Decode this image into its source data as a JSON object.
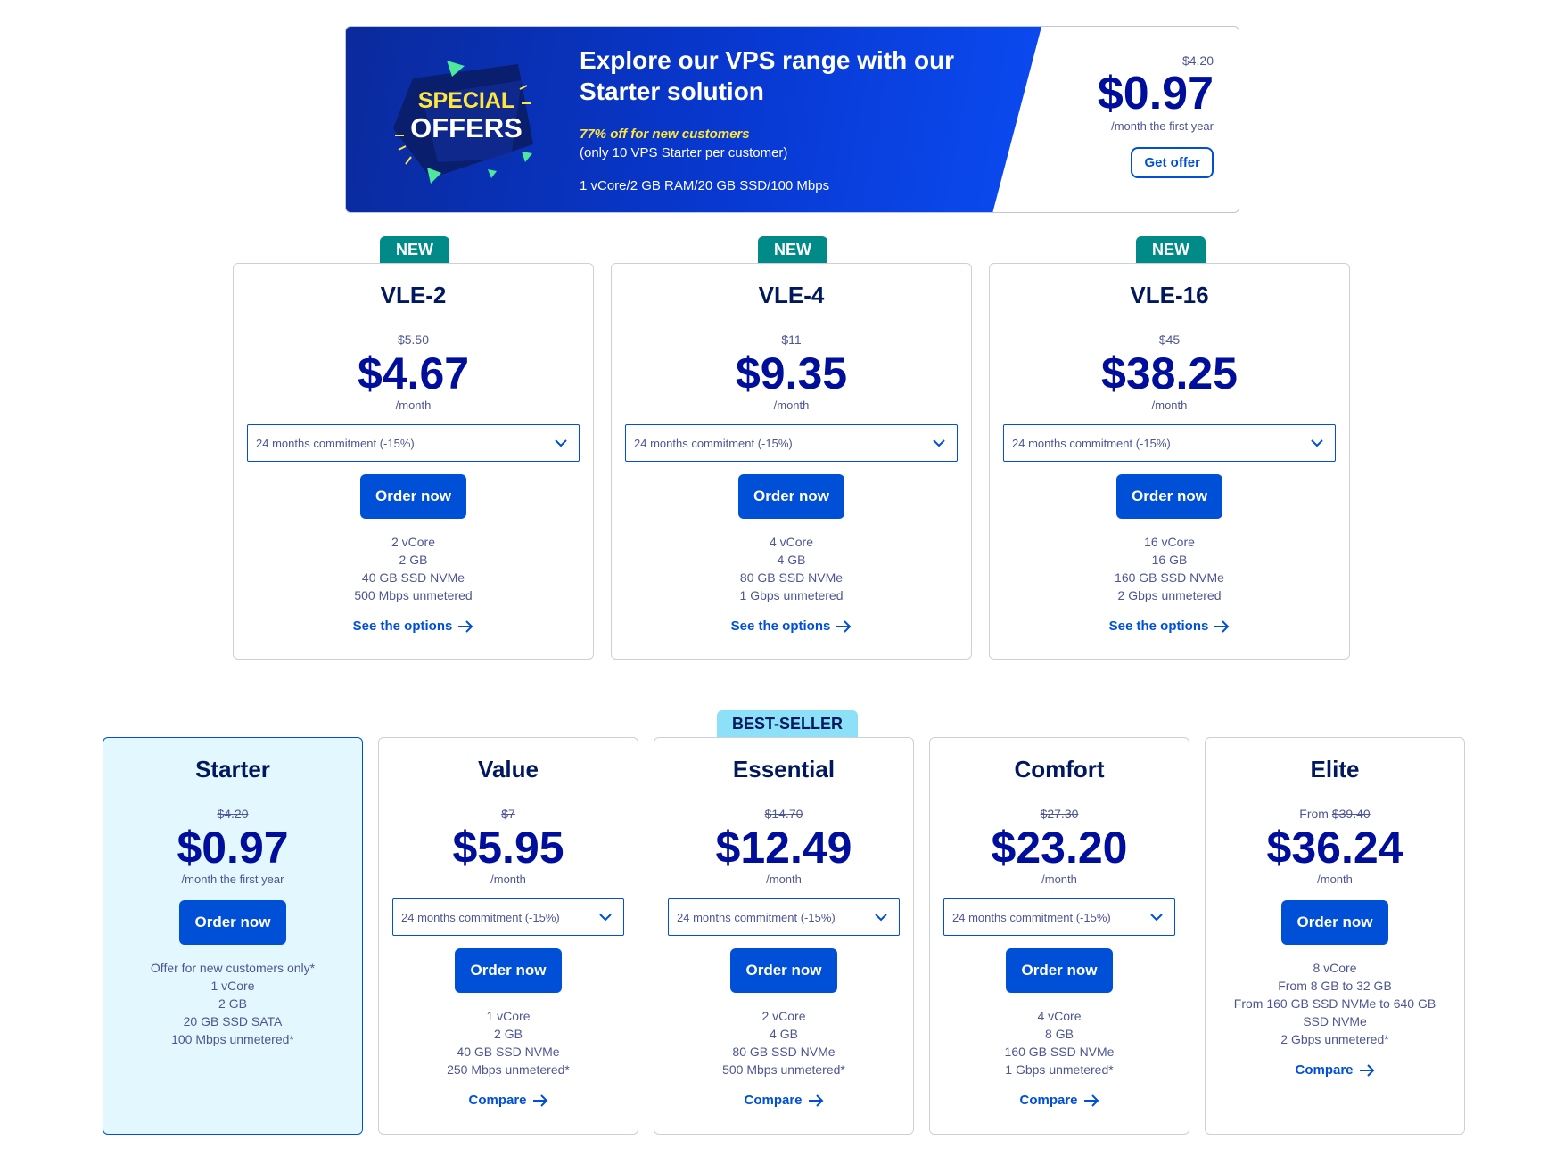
{
  "colors": {
    "primary": "#0050d7",
    "price": "#000e9c",
    "new_tag": "#008a88",
    "best_seller_tag": "#8ce1f8",
    "starter_bg": "#e3f8fe"
  },
  "banner": {
    "badge_line1": "SPECIAL",
    "badge_line2": "OFFERS",
    "title": "Explore our VPS range with our Starter solution",
    "highlight": "77% off for new customers",
    "note": "(only 10 VPS Starter per customer)",
    "spec": "1 vCore/2 GB RAM/20 GB SSD/100 Mbps",
    "old_price": "$4.20",
    "price": "$0.97",
    "period": "/month the first year",
    "button": "Get offer"
  },
  "vle_cards": [
    {
      "tag": "NEW",
      "name": "VLE-2",
      "old_price": "$5.50",
      "price": "$4.67",
      "period": "/month",
      "commitment": "24 months commitment (-15%)",
      "button": "Order now",
      "features": [
        "2 vCore",
        "2 GB",
        "40 GB SSD NVMe",
        "500 Mbps unmetered"
      ],
      "link": "See the options"
    },
    {
      "tag": "NEW",
      "name": "VLE-4",
      "old_price": "$11",
      "price": "$9.35",
      "period": "/month",
      "commitment": "24 months commitment (-15%)",
      "button": "Order now",
      "features": [
        "4 vCore",
        "4 GB",
        "80 GB SSD NVMe",
        "1 Gbps unmetered"
      ],
      "link": "See the options"
    },
    {
      "tag": "NEW",
      "name": "VLE-16",
      "old_price": "$45",
      "price": "$38.25",
      "period": "/month",
      "commitment": "24 months commitment (-15%)",
      "button": "Order now",
      "features": [
        "16 vCore",
        "16 GB",
        "160 GB SSD NVMe",
        "2 Gbps unmetered"
      ],
      "link": "See the options"
    }
  ],
  "range_cards": [
    {
      "name": "Starter",
      "old_price": "$4.20",
      "price": "$0.97",
      "period": "/month the first year",
      "button": "Order now",
      "features": [
        "Offer for new customers only*",
        "1 vCore",
        "2 GB",
        "20 GB SSD SATA",
        "100 Mbps unmetered*"
      ]
    },
    {
      "name": "Value",
      "old_price": "$7",
      "price": "$5.95",
      "period": "/month",
      "commitment": "24 months commitment (-15%)",
      "button": "Order now",
      "features": [
        "1 vCore",
        "2 GB",
        "40 GB SSD NVMe",
        "250 Mbps unmetered*"
      ],
      "link": "Compare"
    },
    {
      "tag": "BEST-SELLER",
      "name": "Essential",
      "old_price": "$14.70",
      "price": "$12.49",
      "period": "/month",
      "commitment": "24 months commitment (-15%)",
      "button": "Order now",
      "features": [
        "2 vCore",
        "4 GB",
        "80 GB SSD NVMe",
        "500 Mbps unmetered*"
      ],
      "link": "Compare"
    },
    {
      "name": "Comfort",
      "old_price": "$27.30",
      "price": "$23.20",
      "period": "/month",
      "commitment": "24 months commitment (-15%)",
      "button": "Order now",
      "features": [
        "4 vCore",
        "8 GB",
        "160 GB SSD NVMe",
        "1 Gbps unmetered*"
      ],
      "link": "Compare"
    },
    {
      "name": "Elite",
      "from_label": "From",
      "old_price": "$39.40",
      "price": "$36.24",
      "period": "/month",
      "button": "Order now",
      "features": [
        "8 vCore",
        "From 8 GB to 32 GB",
        "From 160 GB SSD NVMe to 640 GB SSD NVMe",
        "2 Gbps unmetered*"
      ],
      "link": "Compare"
    }
  ],
  "icons": {
    "select": "chevron-down-icon",
    "link": "arrow-right-icon"
  }
}
